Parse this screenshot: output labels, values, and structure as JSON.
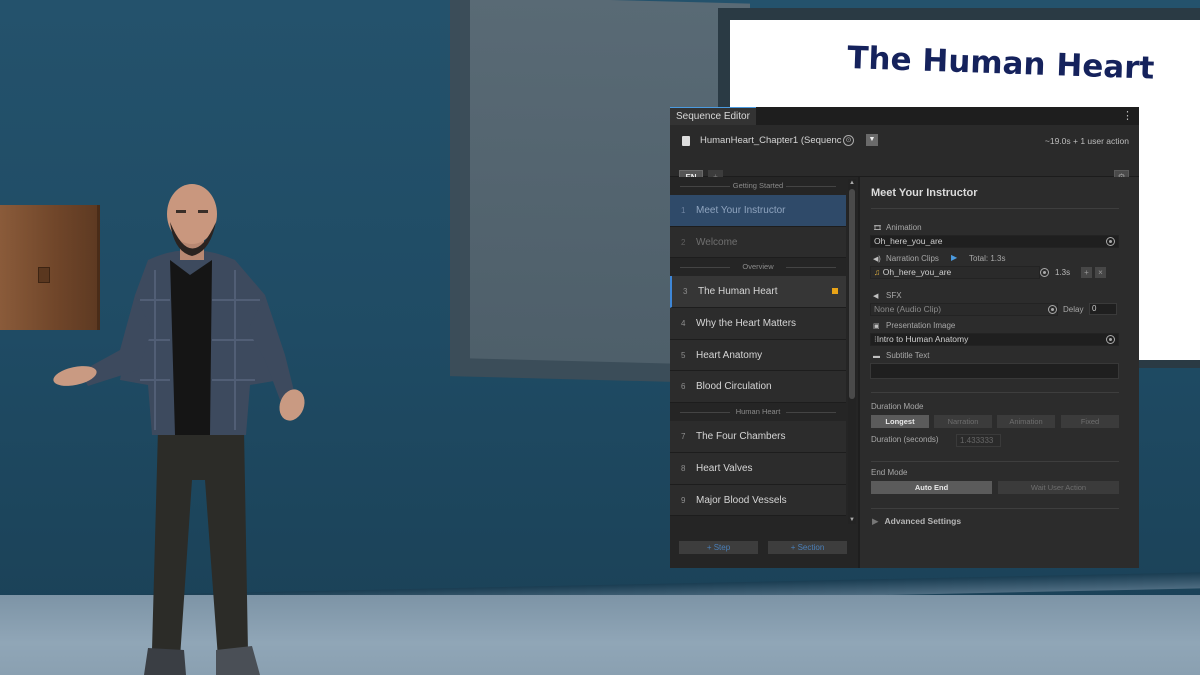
{
  "scene": {
    "screen_title": "The Human Heart"
  },
  "editor": {
    "tab_title": "Sequence Editor",
    "menu_icon": "⋮",
    "sequence_name": "HumanHeart_Chapter1 (Sequenc",
    "stats": "~19.0s + 1 user action",
    "lang": "EN",
    "lang_add": "+",
    "settings_icon": "gear-icon",
    "sections": [
      {
        "title": "Getting Started"
      },
      {
        "title": "Overview"
      },
      {
        "title": "Human Heart"
      }
    ],
    "steps": [
      {
        "num": "1",
        "label": "Meet Your Instructor"
      },
      {
        "num": "2",
        "label": "Welcome"
      },
      {
        "num": "3",
        "label": "The Human Heart"
      },
      {
        "num": "4",
        "label": "Why the Heart Matters"
      },
      {
        "num": "5",
        "label": "Heart Anatomy"
      },
      {
        "num": "6",
        "label": "Blood Circulation"
      },
      {
        "num": "7",
        "label": "The Four Chambers"
      },
      {
        "num": "8",
        "label": "Heart Valves"
      },
      {
        "num": "9",
        "label": "Major Blood Vessels"
      }
    ],
    "add_step": "+ Step",
    "add_section": "+ Section",
    "detail": {
      "title": "Meet Your Instructor",
      "animation_label": "Animation",
      "animation_value": "Oh_here_you_are",
      "narration_label": "Narration Clips",
      "narration_total": "Total: 1.3s",
      "narration_clip": "Oh_here_you_are",
      "narration_clip_len": "1.3s",
      "sfx_label": "SFX",
      "sfx_value": "None (Audio Clip)",
      "delay_label": "Delay",
      "delay_value": "0",
      "image_label": "Presentation Image",
      "image_value": "Intro to Human Anatomy",
      "subtitle_label": "Subtitle Text",
      "subtitle_value": "",
      "duration_mode_label": "Duration Mode",
      "duration_modes": [
        "Longest",
        "Narration",
        "Animation",
        "Fixed"
      ],
      "duration_seconds_label": "Duration (seconds)",
      "duration_seconds_value": "1.433333",
      "end_mode_label": "End Mode",
      "end_modes": [
        "Auto End",
        "Wait User Action"
      ],
      "advanced_label": "Advanced Settings"
    }
  },
  "colors": {
    "accent": "#3e86d6",
    "active_step_bg": "#2f4a69",
    "marker": "#e8a317",
    "panel_bg": "#282828"
  }
}
